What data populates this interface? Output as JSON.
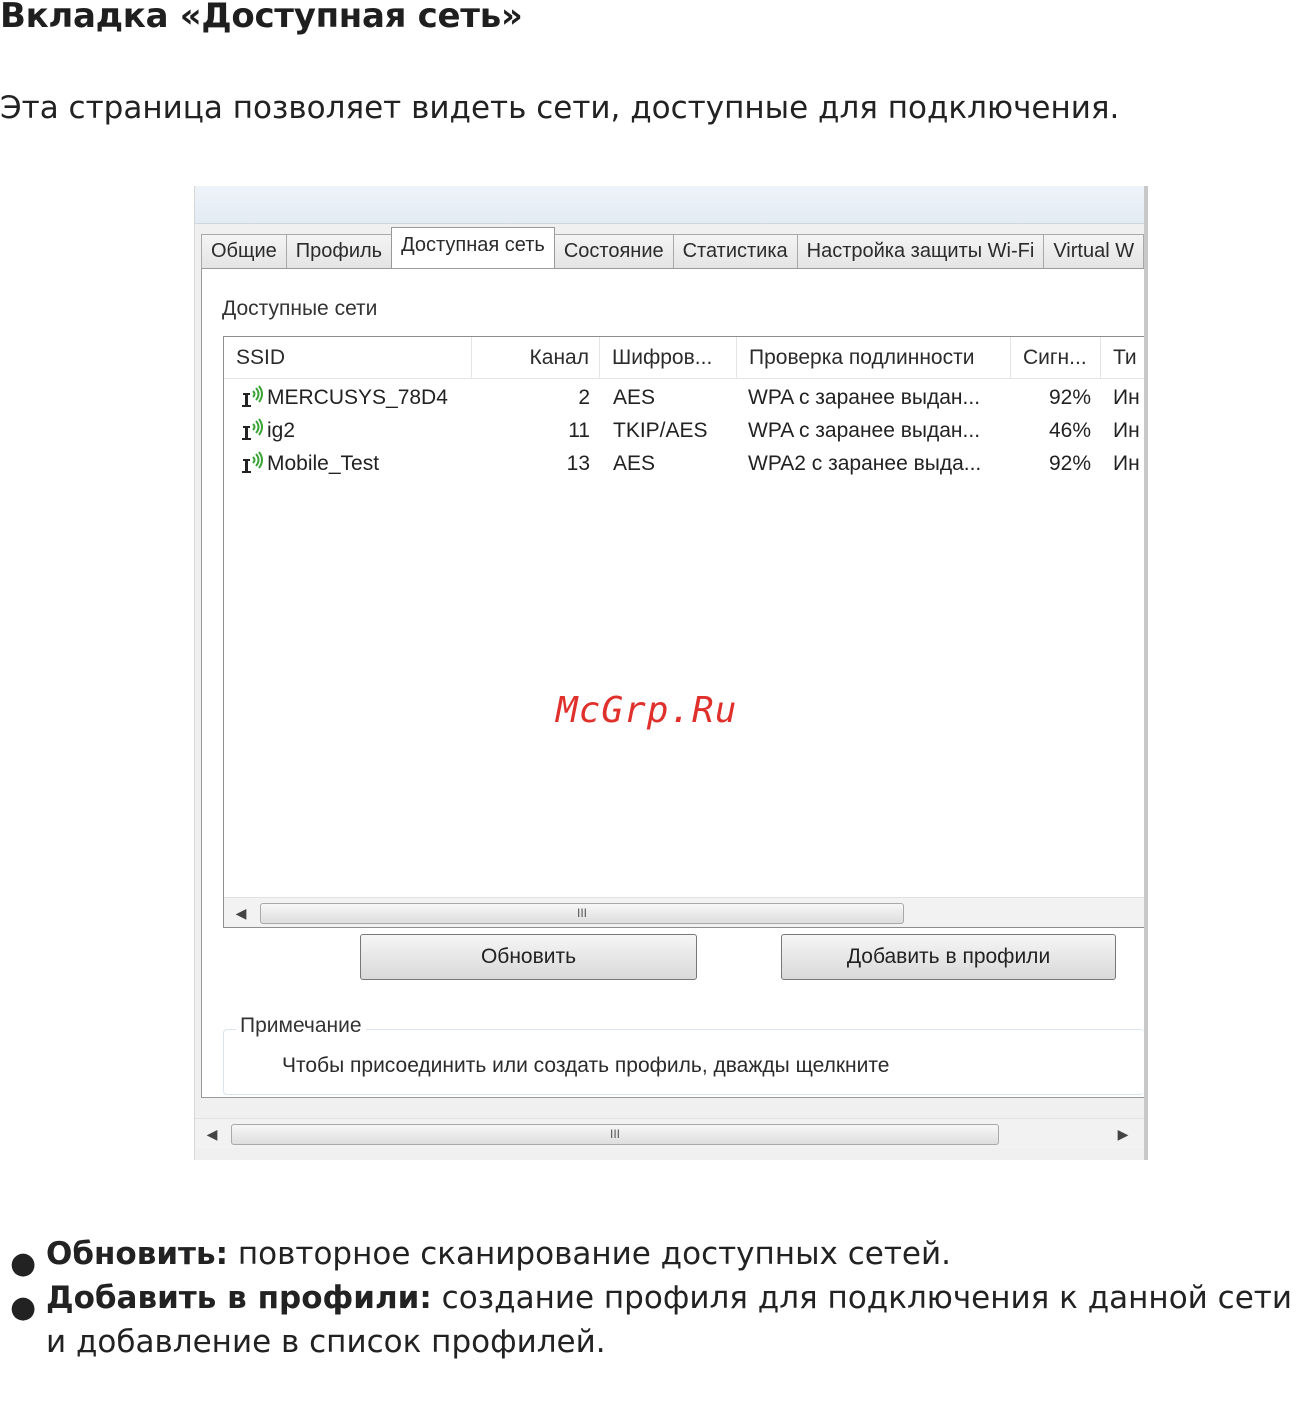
{
  "heading": "Вкладка «Доступная сеть»",
  "intro": "Эта страница позволяет видеть сети, доступные для подключения.",
  "window": {
    "tabs": [
      {
        "label": "Общие",
        "active": false
      },
      {
        "label": "Профиль",
        "active": false
      },
      {
        "label": "Доступная сеть",
        "active": true
      },
      {
        "label": "Состояние",
        "active": false
      },
      {
        "label": "Статистика",
        "active": false
      },
      {
        "label": "Настройка защиты Wi-Fi",
        "active": false
      },
      {
        "label": "Virtual W",
        "active": false
      }
    ],
    "group_label": "Доступные сети",
    "columns": [
      "SSID",
      "Канал",
      "Шифров...",
      "Проверка подлинности",
      "Сигн...",
      "Ти"
    ],
    "networks": [
      {
        "ssid": "MERCUSYS_78D4",
        "channel": "2",
        "encryption": "AES",
        "auth": "WPA с заранее выдан...",
        "signal": "92%",
        "type": "Ин"
      },
      {
        "ssid": "ig2",
        "channel": "11",
        "encryption": "TKIP/AES",
        "auth": "WPA с заранее выдан...",
        "signal": "46%",
        "type": "Ин"
      },
      {
        "ssid": "Mobile_Test",
        "channel": "13",
        "encryption": "AES",
        "auth": "WPA2 с заранее выда...",
        "signal": "92%",
        "type": "Ин"
      }
    ],
    "list_scroll_grip": "III",
    "refresh_button": "Обновить",
    "add_button": "Добавить в профили",
    "note_title": "Примечание",
    "note_text": "Чтобы присоединить или создать профиль, дважды щелкните",
    "window_scroll_grip": "III",
    "wifi_icon_color": "#3aa335"
  },
  "watermark": "McGrp.Ru",
  "bullets": [
    {
      "term": "Обновить:",
      "text": " повторное сканирование доступных сетей."
    },
    {
      "term": "Добавить в профили:",
      "text": " создание профиля для подключения к данной сети и добавление в список профилей."
    }
  ]
}
